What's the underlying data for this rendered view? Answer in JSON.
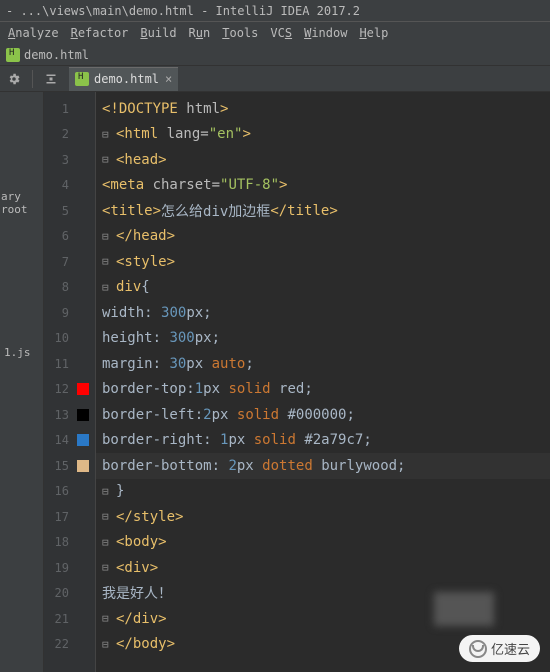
{
  "title": "- ...\\views\\main\\demo.html - IntelliJ IDEA 2017.2",
  "menu": {
    "analyze": "Analyze",
    "refactor": "Refactor",
    "build": "Build",
    "run": "Run",
    "tools": "Tools",
    "vcs": "VCS",
    "window": "Window",
    "help": "Help"
  },
  "breadcrumb": {
    "file": "demo.html"
  },
  "tab": {
    "label": "demo.html"
  },
  "sidebar": {
    "libRoot": "ary root",
    "jsLabel": "1.js"
  },
  "lines": {
    "n1": "1",
    "n2": "2",
    "n3": "3",
    "n4": "4",
    "n5": "5",
    "n6": "6",
    "n7": "7",
    "n8": "8",
    "n9": "9",
    "n10": "10",
    "n11": "11",
    "n12": "12",
    "n13": "13",
    "n14": "14",
    "n15": "15",
    "n16": "16",
    "n17": "17",
    "n18": "18",
    "n19": "19",
    "n20": "20",
    "n21": "21",
    "n22": "22"
  },
  "code": {
    "l1": {
      "doctype": "<!DOCTYPE ",
      "html": "html",
      "close": ">"
    },
    "l2": {
      "open": "<html ",
      "attr": "lang=",
      "val": "\"en\"",
      "close": ">"
    },
    "l3": {
      "open": "<head>"
    },
    "l4": {
      "open": "<meta ",
      "attr": "charset=",
      "val": "\"UTF-8\"",
      "close": ">"
    },
    "l5": {
      "open": "<title>",
      "text": "怎么给div加边框",
      "close": "</title>"
    },
    "l6": {
      "close": "</head>"
    },
    "l7": {
      "open": "<style>"
    },
    "l8": {
      "sel": "div",
      "brace": "{"
    },
    "l9": {
      "prop": "width: ",
      "num": "300",
      "unit": "px",
      "semi": ";"
    },
    "l10": {
      "prop": "height: ",
      "num": "300",
      "unit": "px",
      "semi": ";"
    },
    "l11": {
      "prop": "margin: ",
      "num": "30",
      "unit": "px ",
      "kw": "auto",
      "semi": ";"
    },
    "l12": {
      "prop": "border-top:",
      "num": "1",
      "unit": "px ",
      "kw": "solid ",
      "color": "red",
      "semi": ";"
    },
    "l13": {
      "prop": "border-left:",
      "num": "2",
      "unit": "px ",
      "kw": "solid ",
      "color": "#000000",
      "semi": ";"
    },
    "l14": {
      "prop": "border-right: ",
      "num": "1",
      "unit": "px ",
      "kw": "solid ",
      "color": "#2a79c7",
      "semi": ";"
    },
    "l15": {
      "prop": "border-bottom: ",
      "num": "2",
      "unit": "px ",
      "kw": "dotted ",
      "color": "burlywood",
      "semi": ";"
    },
    "l16": {
      "brace": "}"
    },
    "l17": {
      "close": "</style>"
    },
    "l18": {
      "open": "<body>"
    },
    "l19": {
      "open": "<div>"
    },
    "l20": {
      "text": "我是好人！"
    },
    "l21": {
      "close": "</div>"
    },
    "l22": {
      "close": "</body>"
    }
  },
  "swatches": {
    "red": "#ff0000",
    "black": "#000000",
    "blue": "#2a79c7",
    "burly": "#deb887"
  },
  "watermark": "亿速云"
}
